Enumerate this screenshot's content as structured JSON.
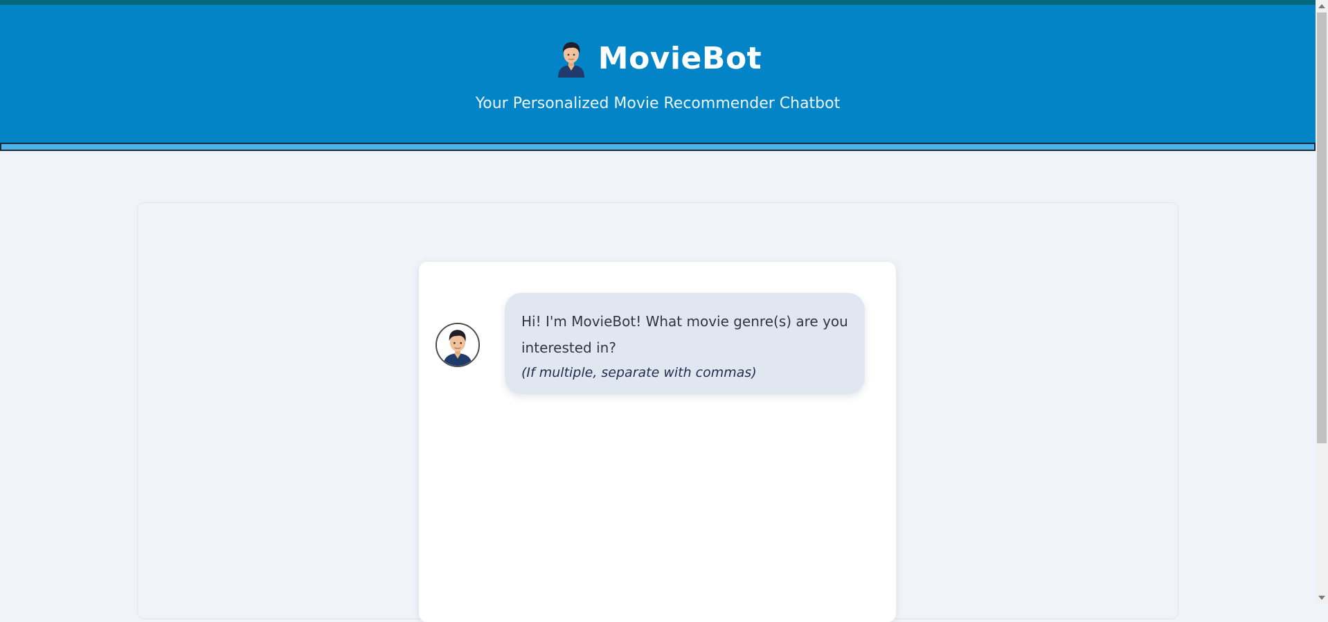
{
  "header": {
    "title": "MovieBot",
    "subtitle": "Your Personalized Movie Recommender Chatbot",
    "logo_icon": "man-avatar-icon",
    "background_color": "#0384c7"
  },
  "chat": {
    "messages": [
      {
        "sender_icon": "bot-avatar-icon",
        "text": "Hi! I'm MovieBot! What movie genre(s) are you interested in?",
        "note": "(If multiple, separate with commas)"
      }
    ]
  }
}
